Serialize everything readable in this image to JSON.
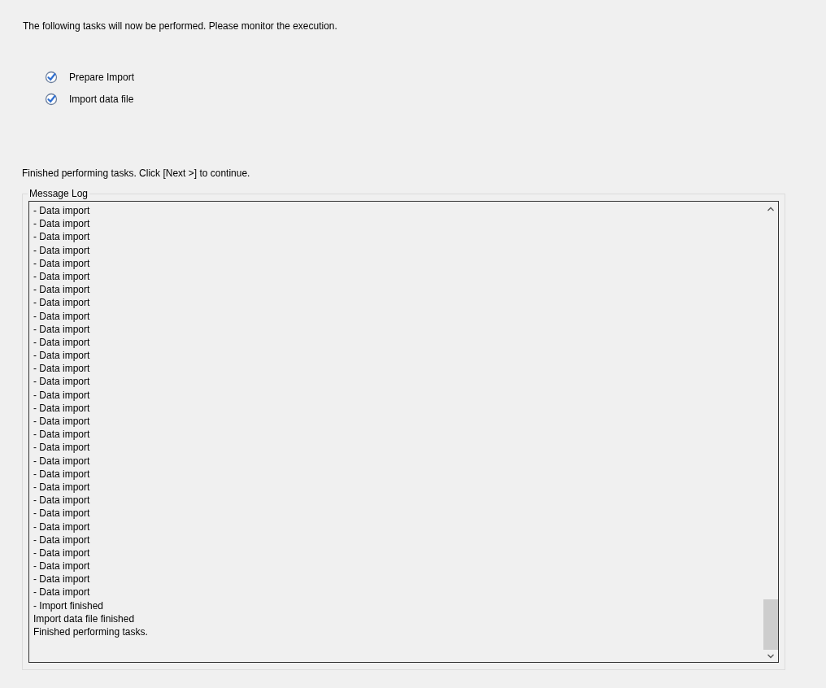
{
  "intro": "The following tasks will now be performed. Please monitor the execution.",
  "tasks": [
    {
      "label": "Prepare Import",
      "checked": true
    },
    {
      "label": "Import data file",
      "checked": true
    }
  ],
  "status": "Finished performing tasks. Click [Next >] to continue.",
  "message_log": {
    "title": "Message Log",
    "lines": [
      "- Data import",
      "- Data import",
      "- Data import",
      "- Data import",
      "- Data import",
      "- Data import",
      "- Data import",
      "- Data import",
      "- Data import",
      "- Data import",
      "- Data import",
      "- Data import",
      "- Data import",
      "- Data import",
      "- Data import",
      "- Data import",
      "- Data import",
      "- Data import",
      "- Data import",
      "- Data import",
      "- Data import",
      "- Data import",
      "- Data import",
      "- Data import",
      "- Data import",
      "- Data import",
      "- Data import",
      "- Data import",
      "- Data import",
      "- Data import",
      "- Import finished",
      "Import data file finished",
      "Finished performing tasks."
    ]
  }
}
